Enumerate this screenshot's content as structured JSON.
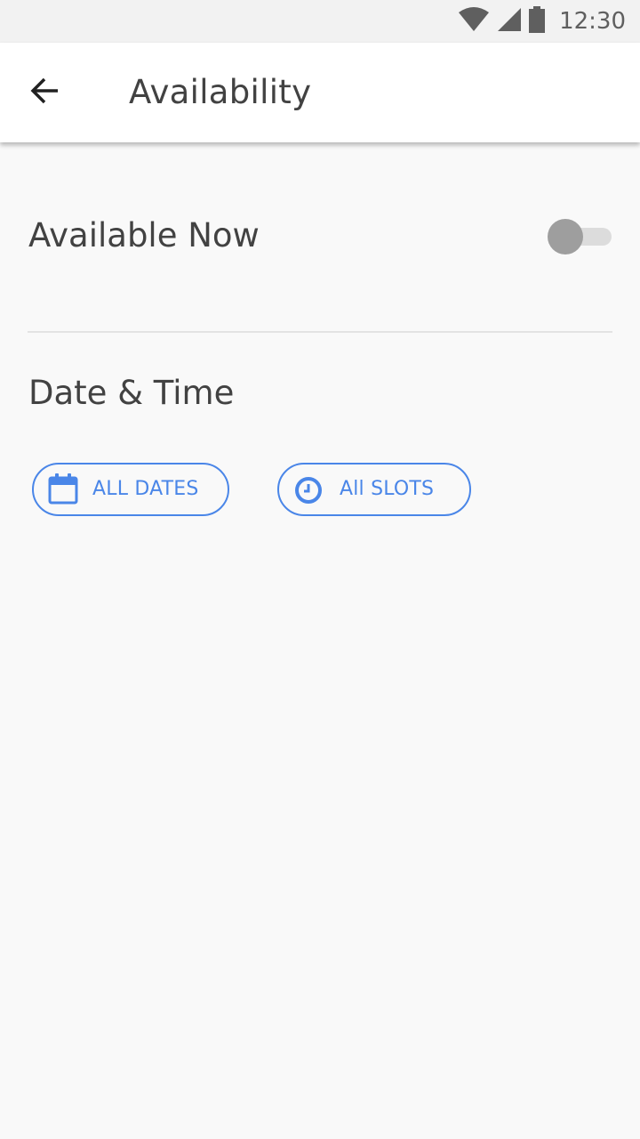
{
  "status_bar": {
    "time": "12:30",
    "icons": [
      "wifi-icon",
      "cell-signal-icon",
      "battery-icon"
    ]
  },
  "app_bar": {
    "title": "Availability",
    "back_icon": "arrow-back-icon"
  },
  "availability": {
    "label": "Available Now",
    "toggle_on": false
  },
  "date_time": {
    "heading": "Date & Time",
    "dates_button": {
      "label": "ALL DATES",
      "icon": "calendar-icon"
    },
    "slots_button": {
      "label": "All SLOTS",
      "icon": "clock-icon"
    }
  },
  "colors": {
    "accent": "#4a86e8",
    "text_primary": "#424242",
    "background": "#f9f9f9",
    "status_bar": "#f2f2f2",
    "toggle_thumb_off": "#9e9e9e",
    "toggle_track_off": "#dcdcdc"
  }
}
